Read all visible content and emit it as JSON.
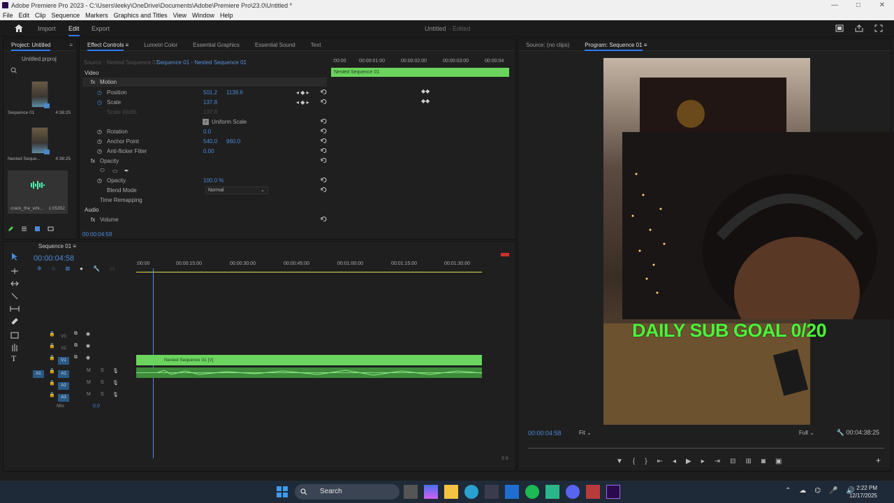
{
  "window": {
    "title": "Adobe Premiere Pro 2023 - C:\\Users\\leeky\\OneDrive\\Documents\\Adobe\\Premiere Pro\\23.0\\Untitled *",
    "controls": [
      "—",
      "□",
      "✕"
    ]
  },
  "menu": [
    "File",
    "Edit",
    "Clip",
    "Sequence",
    "Markers",
    "Graphics and Titles",
    "View",
    "Window",
    "Help"
  ],
  "workspace": {
    "tabs": [
      "Import",
      "Edit",
      "Export"
    ],
    "active_tab": "Edit",
    "project_title": "Untitled",
    "status": "- Edited"
  },
  "project_panel": {
    "tab": "Project: Untitled",
    "file": "Untitled.prproj",
    "items": [
      {
        "name": "Sequence 01",
        "duration": "4:38:25"
      },
      {
        "name": "Nested Seque...",
        "duration": "4:38:25"
      },
      {
        "name": "crack_the_whi...",
        "duration": "1:05352"
      }
    ]
  },
  "effect_controls": {
    "tabs": [
      "Effect Controls",
      "Lumetri Color",
      "Essential Graphics",
      "Essential Sound",
      "Text"
    ],
    "source": "Source - Nested Sequence 01",
    "sequence": "Sequence 01 - Nested Sequence 01",
    "sections": {
      "video": "Video",
      "audio": "Audio"
    },
    "effects": {
      "motion": "Motion",
      "position": {
        "label": "Position",
        "x": "501.2",
        "y": "1139.6"
      },
      "scale": {
        "label": "Scale",
        "value": "137.8"
      },
      "scale_width": {
        "label": "Scale Width",
        "value": "137.8"
      },
      "uniform_scale": "Uniform Scale",
      "rotation": {
        "label": "Rotation",
        "value": "0.0"
      },
      "anchor_point": {
        "label": "Anchor Point",
        "x": "540.0",
        "y": "960.0"
      },
      "anti_flicker": {
        "label": "Anti-flicker Filter",
        "value": "0.00"
      },
      "opacity_section": "Opacity",
      "opacity": {
        "label": "Opacity",
        "value": "100.0 %"
      },
      "blend_mode": {
        "label": "Blend Mode",
        "value": "Normal"
      },
      "time_remapping": "Time Remapping",
      "volume": "Volume"
    },
    "ruler": [
      ":00:00",
      "00:00:01:00",
      "00:00:02:00",
      "00:00:03:00",
      "00:00:04"
    ],
    "clip_label": "Nested Sequence 01",
    "timecode": "00:00:04:58"
  },
  "program_monitor": {
    "tabs": [
      "Source: (no clips)",
      "Program: Sequence 01"
    ],
    "overlay_text": "DAILY SUB GOAL 0/20",
    "timecode": "00:00:04:58",
    "fit": "Fit",
    "resolution": "Full",
    "duration": "00:04:38:25"
  },
  "timeline": {
    "sequence": "Sequence 01",
    "timecode": "00:00:04:58",
    "ruler": [
      ":00:00",
      "00:00:15:00",
      "00:00:30:00",
      "00:00:45:00",
      "00:01:00:00",
      "00:01:15:00",
      "00:01:30:00"
    ],
    "tracks": {
      "video": [
        "V3",
        "V2",
        "V1"
      ],
      "audio": [
        "A1",
        "A2",
        "A3"
      ],
      "source_patch": "A1",
      "source_patch_video": "V1",
      "mix": "Mix",
      "mix_value": "0.0"
    },
    "clip_label": "Nested Sequence 01 [V]",
    "meter_label": "S S"
  },
  "taskbar": {
    "search": "Search",
    "time": "2:22 PM",
    "date": "12/17/2025"
  }
}
